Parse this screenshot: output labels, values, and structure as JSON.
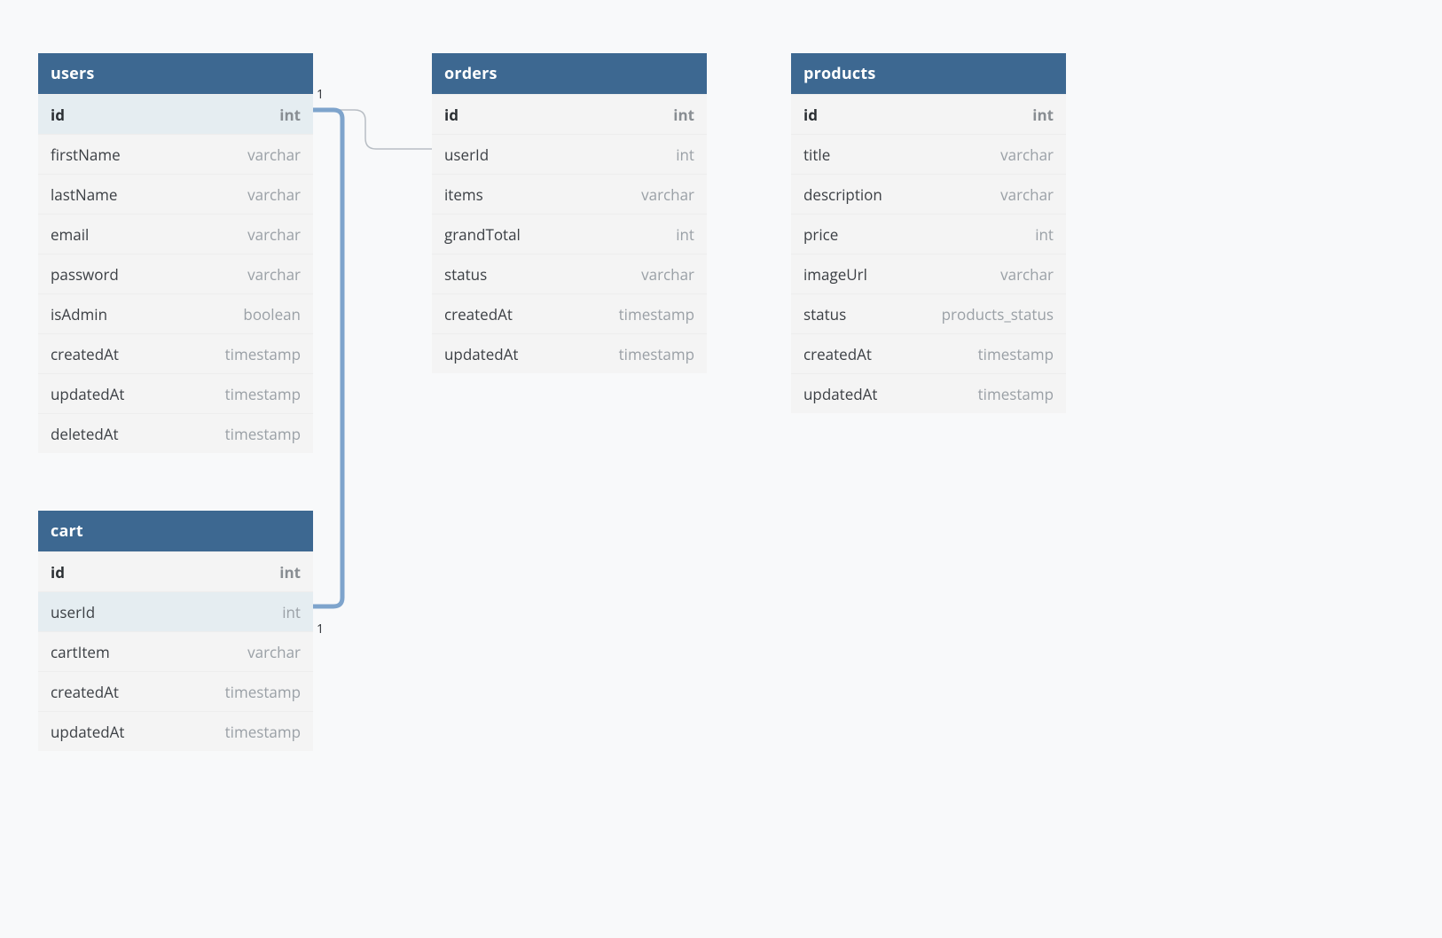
{
  "entities": {
    "users": {
      "title": "users",
      "columns": [
        {
          "name": "id",
          "type": "int",
          "pk": true,
          "highlight": true
        },
        {
          "name": "firstName",
          "type": "varchar"
        },
        {
          "name": "lastName",
          "type": "varchar"
        },
        {
          "name": "email",
          "type": "varchar"
        },
        {
          "name": "password",
          "type": "varchar"
        },
        {
          "name": "isAdmin",
          "type": "boolean"
        },
        {
          "name": "createdAt",
          "type": "timestamp"
        },
        {
          "name": "updatedAt",
          "type": "timestamp"
        },
        {
          "name": "deletedAt",
          "type": "timestamp"
        }
      ]
    },
    "orders": {
      "title": "orders",
      "columns": [
        {
          "name": "id",
          "type": "int",
          "pk": true
        },
        {
          "name": "userId",
          "type": "int"
        },
        {
          "name": "items",
          "type": "varchar"
        },
        {
          "name": "grandTotal",
          "type": "int"
        },
        {
          "name": "status",
          "type": "varchar"
        },
        {
          "name": "createdAt",
          "type": "timestamp"
        },
        {
          "name": "updatedAt",
          "type": "timestamp"
        }
      ]
    },
    "products": {
      "title": "products",
      "columns": [
        {
          "name": "id",
          "type": "int",
          "pk": true
        },
        {
          "name": "title",
          "type": "varchar"
        },
        {
          "name": "description",
          "type": "varchar"
        },
        {
          "name": "price",
          "type": "int"
        },
        {
          "name": "imageUrl",
          "type": "varchar"
        },
        {
          "name": "status",
          "type": "products_status"
        },
        {
          "name": "createdAt",
          "type": "timestamp"
        },
        {
          "name": "updatedAt",
          "type": "timestamp"
        }
      ]
    },
    "cart": {
      "title": "cart",
      "columns": [
        {
          "name": "id",
          "type": "int",
          "pk": true
        },
        {
          "name": "userId",
          "type": "int",
          "highlight": true
        },
        {
          "name": "cartItem",
          "type": "varchar"
        },
        {
          "name": "createdAt",
          "type": "timestamp"
        },
        {
          "name": "updatedAt",
          "type": "timestamp"
        }
      ]
    }
  },
  "relationships": [
    {
      "from": "users.id",
      "to": "orders.userId",
      "fromCardinality": "1",
      "toCardinality": ""
    },
    {
      "from": "users.id",
      "to": "cart.userId",
      "fromCardinality": "1",
      "toCardinality": "1"
    }
  ],
  "cardinalityLabels": {
    "usersIdRight": "1",
    "cartUserIdRight": "1"
  }
}
